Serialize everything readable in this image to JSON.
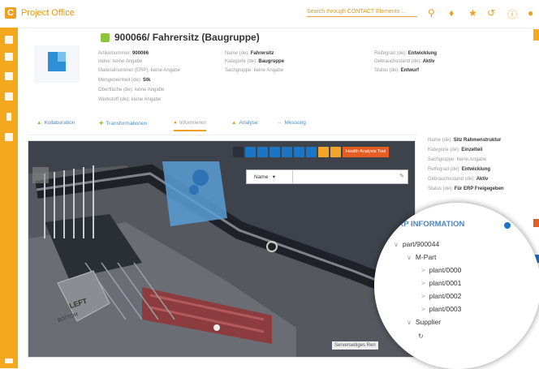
{
  "app": {
    "title": "Project Office",
    "logo": "C"
  },
  "search": {
    "placeholder": "Search through CONTACT Elements ..."
  },
  "top_icons": [
    "search-icon",
    "bell-icon",
    "star-icon",
    "settings-icon",
    "history-icon",
    "info-icon",
    "user-icon"
  ],
  "part": {
    "title": "900066/ Fahrersitz (Baugruppe)"
  },
  "attrs_col1": [
    {
      "label": "Artikelnummer:",
      "value": "900066"
    },
    {
      "label": "Index:",
      "value": "keine Angabe"
    },
    {
      "label": "Materialnummer (ERP):",
      "value": "keine Angabe"
    },
    {
      "label": "Mengeneinheit (de):",
      "value": "Stk"
    },
    {
      "label": "Oberfläche (de):",
      "value": "keine Angabe"
    },
    {
      "label": "Werkstoff (de):",
      "value": "keine Angabe"
    }
  ],
  "attrs_col2": [
    {
      "label": "Name (de):",
      "value": "Fahrersitz"
    },
    {
      "label": "Kategorie (de):",
      "value": "Baugruppe"
    },
    {
      "label": "Sachgruppe:",
      "value": "keine Angabe"
    }
  ],
  "attrs_col3": [
    {
      "label": "Reifegrad (de):",
      "value": "Entwicklung"
    },
    {
      "label": "Gebrauchsstand (de):",
      "value": "Aktiv"
    },
    {
      "label": "Status (de):",
      "value": "Entwurf"
    }
  ],
  "tabs": [
    {
      "label": "Kollaboration",
      "icon": "people-icon"
    },
    {
      "label": "Transformationen",
      "icon": "transform-icon"
    },
    {
      "label": "Informieren",
      "icon": "info-icon",
      "active": true
    },
    {
      "label": "Analyse",
      "icon": "warning-icon"
    },
    {
      "label": "Messung",
      "icon": "ruler-icon"
    }
  ],
  "viewer": {
    "tool_button": "Health Analysis Tool",
    "filter_label": "Name",
    "cube_left": "LEFT",
    "cube_bottom": "BOTTOM",
    "server_label": "Serverseitiges Ren"
  },
  "right_attrs": [
    {
      "label": "Name (de):",
      "value": "Sitz Rahmenstruktur"
    },
    {
      "label": "Kategorie (de):",
      "value": "Einzelteil"
    },
    {
      "label": "Sachgruppe:",
      "value": "keine Angabe"
    },
    {
      "label": "Reifegrad (de):",
      "value": "Entwicklung"
    },
    {
      "label": "Gebrauchsstand (de):",
      "value": "Aktiv"
    },
    {
      "label": "Status (de):",
      "value": "Für ERP Freigegeben"
    }
  ],
  "erp": {
    "title": "ERP INFORMATION",
    "root": "part/900044",
    "mpart": "M-Part",
    "plants": [
      "plant/0000",
      "plant/0001",
      "plant/0002",
      "plant/0003"
    ],
    "supplier": "Supplier"
  },
  "colors": {
    "accent": "#f4a81d",
    "link": "#4a8fc6",
    "erp": "#4f84b8"
  }
}
